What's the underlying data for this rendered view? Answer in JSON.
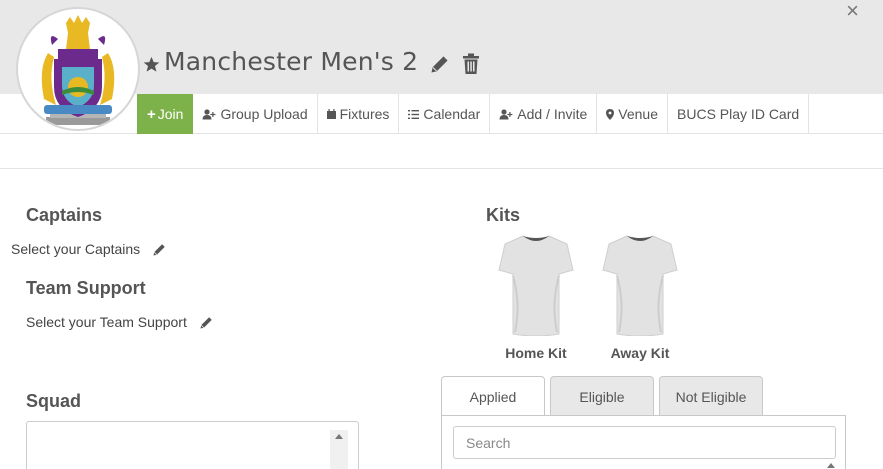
{
  "header": {
    "team_name": "Manchester Men's 2",
    "close_symbol": "×",
    "logo_icon": "crest-logo-icon"
  },
  "nav": {
    "join": "Join",
    "group_upload": "Group Upload",
    "fixtures": "Fixtures",
    "calendar": "Calendar",
    "add_invite": "Add / Invite",
    "venue": "Venue",
    "bucs_card": "BUCS Play ID Card"
  },
  "captains": {
    "heading": "Captains",
    "select_text": "Select your Captains"
  },
  "team_support": {
    "heading": "Team Support",
    "select_text": "Select your Team Support"
  },
  "squad": {
    "heading": "Squad"
  },
  "kits": {
    "heading": "Kits",
    "home_label": "Home Kit",
    "away_label": "Away Kit"
  },
  "tabs": {
    "applied": "Applied",
    "eligible": "Eligible",
    "not_eligible": "Not Eligible"
  },
  "search": {
    "placeholder": "Search"
  },
  "colors": {
    "header_bg": "#e8e8e8",
    "join_green": "#7cb249",
    "crest_purple": "#6b2a8c",
    "crest_gold": "#e8b923"
  }
}
